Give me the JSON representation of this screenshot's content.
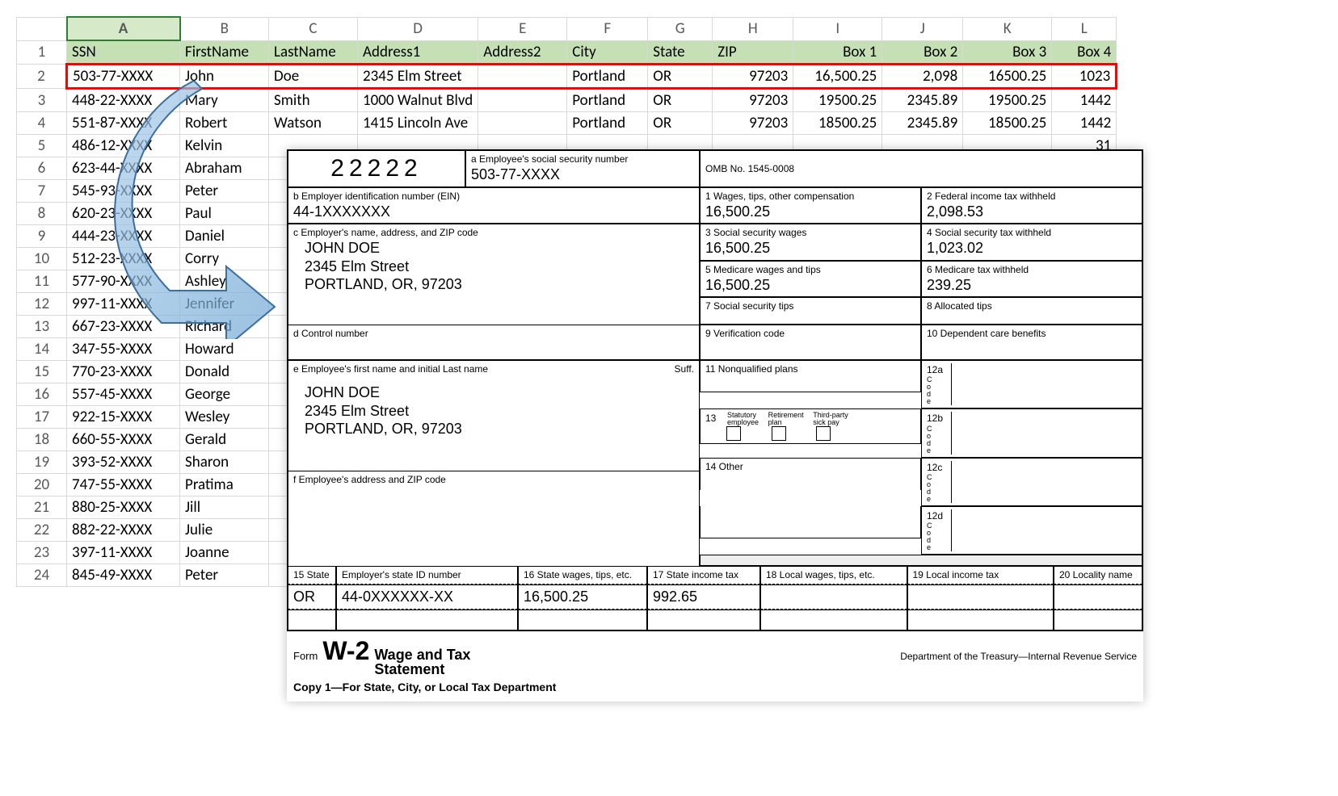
{
  "sheet": {
    "col_letters": [
      "A",
      "B",
      "C",
      "D",
      "E",
      "F",
      "G",
      "H",
      "I",
      "J",
      "K",
      "L"
    ],
    "headers": [
      "SSN",
      "FirstName",
      "LastName",
      "Address1",
      "Address2",
      "City",
      "State",
      "ZIP",
      "Box 1",
      "Box 2",
      "Box 3",
      "Box 4"
    ],
    "rows": [
      {
        "n": 2,
        "hl": true,
        "c": [
          "503-77-XXXX",
          "John",
          "Doe",
          "2345 Elm Street",
          "",
          "Portland",
          "OR",
          "97203",
          "16,500.25",
          "2,098",
          "16500.25",
          "1023"
        ]
      },
      {
        "n": 3,
        "c": [
          "448-22-XXXX",
          "Mary",
          "Smith",
          "1000 Walnut Blvd",
          "",
          "Portland",
          "OR",
          "97203",
          "19500.25",
          "2345.89",
          "19500.25",
          "1442"
        ]
      },
      {
        "n": 4,
        "c": [
          "551-87-XXXX",
          "Robert",
          "Watson",
          "1415 Lincoln Ave",
          "",
          "Portland",
          "OR",
          "97203",
          "18500.25",
          "2345.89",
          "18500.25",
          "1442"
        ]
      },
      {
        "n": 5,
        "c": [
          "486-12-XXXX",
          "Kelvin",
          "",
          "",
          "",
          "",
          "",
          "",
          "",
          "",
          "",
          "31"
        ]
      },
      {
        "n": 6,
        "c": [
          "623-44-XXXX",
          "Abraham"
        ]
      },
      {
        "n": 7,
        "c": [
          "545-93-XXXX",
          "Peter"
        ]
      },
      {
        "n": 8,
        "c": [
          "620-23-XXXX",
          "Paul"
        ]
      },
      {
        "n": 9,
        "c": [
          "444-23-XXXX",
          "Daniel"
        ]
      },
      {
        "n": 10,
        "c": [
          "512-23-XXXX",
          "Corry"
        ]
      },
      {
        "n": 11,
        "c": [
          "577-90-XXXX",
          "Ashley"
        ]
      },
      {
        "n": 12,
        "c": [
          "997-11-XXXX",
          "Jennifer"
        ]
      },
      {
        "n": 13,
        "c": [
          "667-23-XXXX",
          "Richard"
        ]
      },
      {
        "n": 14,
        "c": [
          "347-55-XXXX",
          "Howard"
        ]
      },
      {
        "n": 15,
        "c": [
          "770-23-XXXX",
          "Donald"
        ]
      },
      {
        "n": 16,
        "c": [
          "557-45-XXXX",
          "George"
        ]
      },
      {
        "n": 17,
        "c": [
          "922-15-XXXX",
          "Wesley"
        ]
      },
      {
        "n": 18,
        "c": [
          "660-55-XXXX",
          "Gerald"
        ]
      },
      {
        "n": 19,
        "c": [
          "393-52-XXXX",
          "Sharon"
        ]
      },
      {
        "n": 20,
        "c": [
          "747-55-XXXX",
          "Pratima"
        ]
      },
      {
        "n": 21,
        "c": [
          "880-25-XXXX",
          "Jill"
        ]
      },
      {
        "n": 22,
        "c": [
          "882-22-XXXX",
          "Julie"
        ]
      },
      {
        "n": 23,
        "c": [
          "397-11-XXXX",
          "Joanne"
        ]
      },
      {
        "n": 24,
        "c": [
          "845-49-XXXX",
          "Peter"
        ]
      }
    ]
  },
  "w2": {
    "top_num": "22222",
    "a_lab": "a  Employee's social security number",
    "a_val": "503-77-XXXX",
    "omb": "OMB No. 1545-0008",
    "b_lab": "b  Employer identification number (EIN)",
    "b_val": "44-1XXXXXXX",
    "c_lab": "c  Employer's name, address, and ZIP code",
    "c_name": "JOHN DOE",
    "c_addr1": "2345 Elm Street",
    "c_addr2": "PORTLAND, OR, 97203",
    "d_lab": "d  Control number",
    "e_lab": "e  Employee's first name and initial       Last name",
    "e_suff": "Suff.",
    "e_name": "JOHN DOE",
    "e_addr1": "2345 Elm Street",
    "e_addr2": "PORTLAND, OR, 97203",
    "f_lab": "f  Employee's address and ZIP code",
    "b1_lab": "1   Wages, tips, other compensation",
    "b1_val": "16,500.25",
    "b2_lab": "2   Federal income tax withheld",
    "b2_val": "2,098.53",
    "b3_lab": "3   Social security wages",
    "b3_val": "16,500.25",
    "b4_lab": "4   Social security tax withheld",
    "b4_val": "1,023.02",
    "b5_lab": "5   Medicare wages and tips",
    "b5_val": "16,500.25",
    "b6_lab": "6   Medicare tax withheld",
    "b6_val": "239.25",
    "b7_lab": "7   Social security tips",
    "b8_lab": "8   Allocated tips",
    "b9_lab": "9   Verification code",
    "b10_lab": "10   Dependent care benefits",
    "b11_lab": "11   Nonqualified plans",
    "b12a": "12a",
    "b12b": "12b",
    "b12c": "12c",
    "b12d": "12d",
    "code": "C\no\nd\ne",
    "b13_lab": "13",
    "b13_a": "Statutory\nemployee",
    "b13_b": "Retirement\nplan",
    "b13_c": "Third-party\nsick pay",
    "b14_lab": "14   Other",
    "b15_lab": "15   State",
    "b15_state": "OR",
    "b15_emp_lab": "Employer's state ID number",
    "b15_emp_val": "44-0XXXXXX-XX",
    "b16_lab": "16   State wages, tips, etc.",
    "b16_val": "16,500.25",
    "b17_lab": "17   State income tax",
    "b17_val": "992.65",
    "b18_lab": "18   Local wages, tips, etc.",
    "b19_lab": "19   Local income tax",
    "b20_lab": "20   Locality name",
    "foot_form": "Form",
    "foot_w2": "W-2",
    "foot_title1": "Wage and Tax",
    "foot_title2": "Statement",
    "foot_right": "Department of the Treasury—Internal Revenue Service",
    "foot_copy": "Copy 1—For State, City, or Local Tax Department"
  }
}
